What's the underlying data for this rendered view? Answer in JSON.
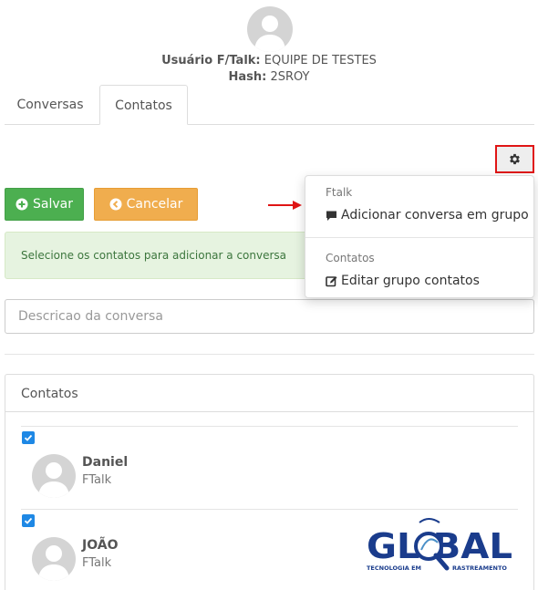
{
  "profile": {
    "user_label": "Usuário F/Talk:",
    "user_value": " EQUIPE DE TESTES",
    "hash_label": "Hash:",
    "hash_value": " 2SROY"
  },
  "tabs": [
    {
      "label": "Conversas",
      "active": false
    },
    {
      "label": "Contatos",
      "active": true
    }
  ],
  "toolbar": {
    "gear_icon": "gear-icon",
    "save_label": "Salvar",
    "cancel_label": "Cancelar"
  },
  "info": {
    "text": "Selecione os contatos para adicionar a conversa"
  },
  "description": {
    "placeholder": "Descricao da conversa",
    "value": ""
  },
  "contacts_panel": {
    "title": "Contatos",
    "items": [
      {
        "name": "Daniel",
        "subtitle": "FTalk",
        "checked": true
      },
      {
        "name": "JOÃO",
        "subtitle": "FTalk",
        "checked": true
      }
    ]
  },
  "dropdown": {
    "sections": [
      {
        "header": "Ftalk",
        "item": "Adicionar conversa em grupo",
        "icon": "comment-icon"
      },
      {
        "header": "Contatos",
        "item": "Editar grupo contatos",
        "icon": "edit-icon"
      }
    ]
  },
  "logo": {
    "word": "GLOBAL",
    "tagline_left": "TECNOLOGIA EM",
    "tagline_right": "RASTREAMENTO"
  },
  "colors": {
    "success": "#4caf50",
    "warning": "#f0ad4e",
    "info_bg": "#e6f3e0",
    "checkbox": "#1e88e5",
    "highlight": "#e01515",
    "logo_blue": "#1a3c8c"
  }
}
